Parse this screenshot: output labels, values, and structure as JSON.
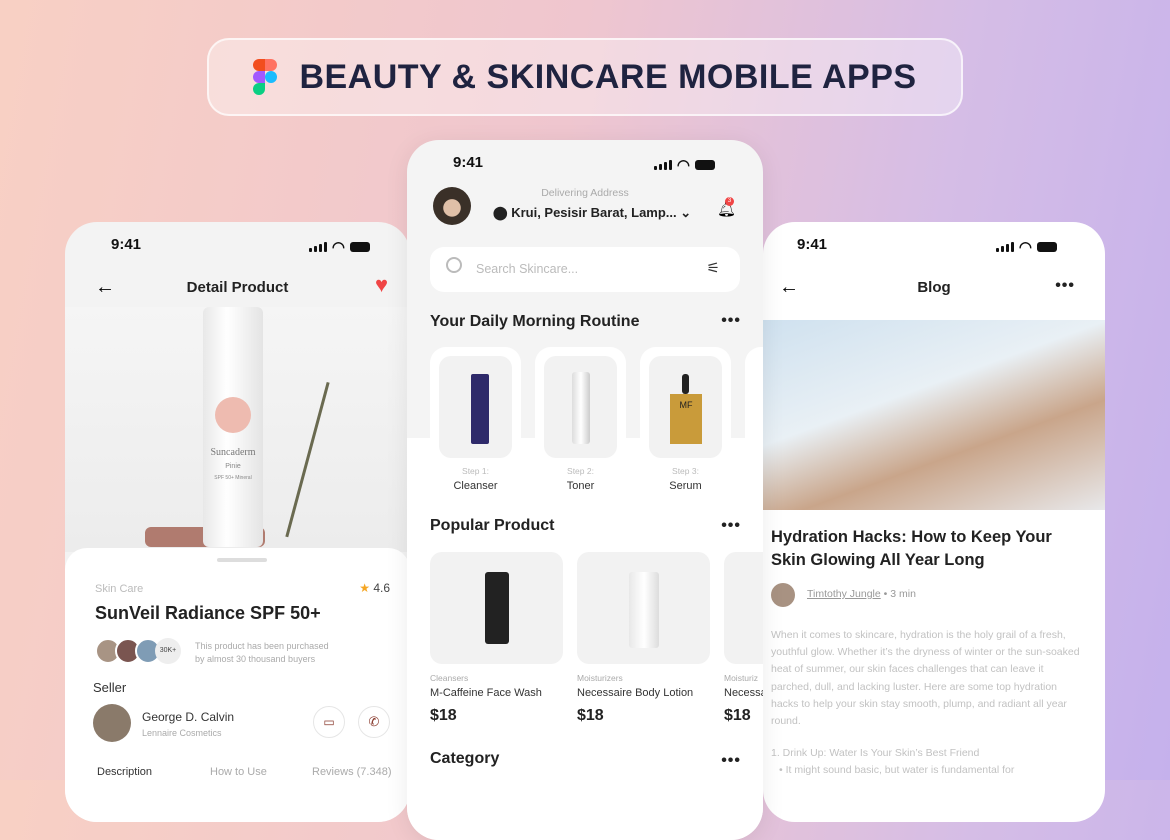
{
  "banner": {
    "title": "BEAUTY & SKINCARE MOBILE APPS"
  },
  "status_time": "9:41",
  "detail": {
    "header": "Detail Product",
    "category": "Skin Care",
    "rating": "4.6",
    "name": "SunVeil Radiance SPF 50+",
    "buyers_badge": "30K+",
    "buyers_text_1": "This product has been purchased",
    "buyers_text_2": "by almost 30 thousand buyers",
    "seller_label": "Seller",
    "seller_name": "George D. Calvin",
    "seller_company": "Lennaire Cosmetics",
    "tabs": [
      "Description",
      "How to Use",
      "Reviews (7.348)"
    ],
    "bottle_brand": "Suncaderm",
    "bottle_sub": "Pinie",
    "bottle_spf": "SPF 50+ Mineral"
  },
  "home": {
    "address_label": "Delivering Address",
    "address": "Krui, Pesisir Barat, Lamp...",
    "notif_count": "3",
    "search_placeholder": "Search Skincare...",
    "routine_title": "Your Daily Morning Routine",
    "routine": [
      {
        "step": "Step 1:",
        "name": "Cleanser"
      },
      {
        "step": "Step 2:",
        "name": "Toner"
      },
      {
        "step": "Step 3:",
        "name": "Serum"
      }
    ],
    "popular_title": "Popular Product",
    "products": [
      {
        "cat": "Cleansers",
        "name": "M-Caffeine Face Wash",
        "price": "$18"
      },
      {
        "cat": "Moisturizers",
        "name": "Necessaire Body Lotion",
        "price": "$18"
      },
      {
        "cat": "Moisturiz",
        "name": "Necessa",
        "price": "$18"
      }
    ],
    "category_title": "Category",
    "serum_label": "MF"
  },
  "blog": {
    "header": "Blog",
    "title": "Hydration Hacks: How to Keep Your Skin Glowing All Year Long",
    "author": "Timtothy Jungle",
    "read_time": "• 3 min",
    "body": "When it comes to skincare, hydration is the holy grail of a fresh, youthful glow. Whether it’s the dryness of winter or the sun-soaked heat of summer, our skin faces challenges that can leave it parched, dull, and lacking luster. Here are some top hydration hacks to help your skin stay smooth, plump, and radiant all year round.",
    "point1": "1. Drink Up: Water Is Your Skin’s Best Friend",
    "bullet1": "It might sound basic, but water is fundamental for"
  },
  "colors": {
    "heart": "#f04545",
    "star": "#f5a623",
    "accent": "#8a3b2e",
    "title": "#1f2340"
  }
}
